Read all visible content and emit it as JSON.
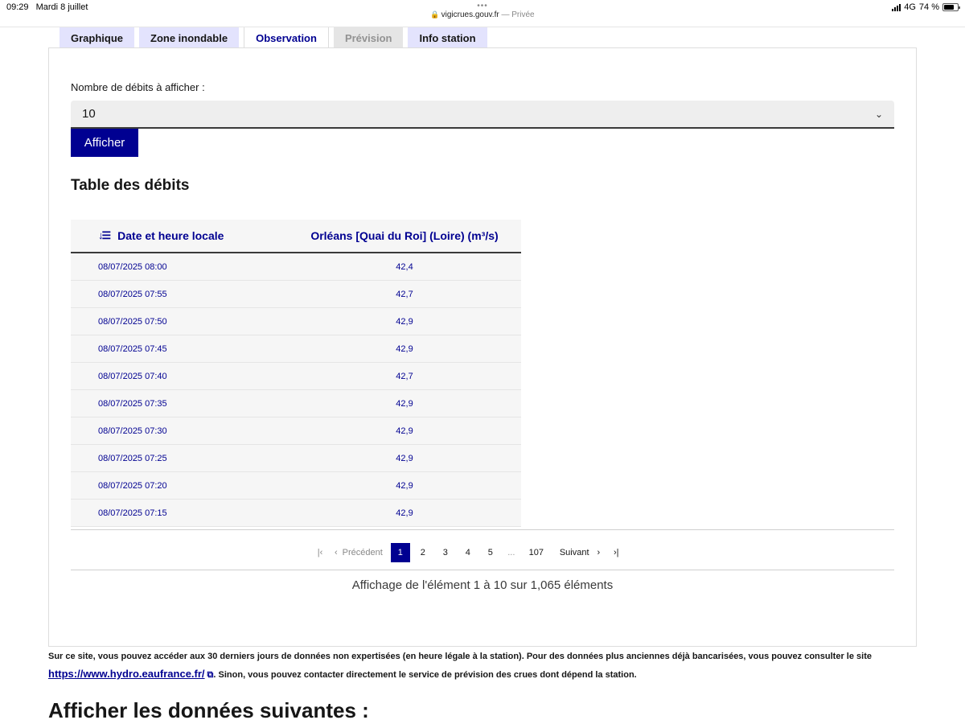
{
  "status_bar": {
    "time": "09:29",
    "date": "Mardi 8 juillet",
    "dots": "•••",
    "url": "vigicrues.gouv.fr",
    "privacy": "— Privée",
    "network": "4G",
    "battery": "74 %",
    "battery_level": 0.74
  },
  "tabs": [
    {
      "label": "Graphique",
      "state": "normal"
    },
    {
      "label": "Zone inondable",
      "state": "normal"
    },
    {
      "label": "Observation",
      "state": "active"
    },
    {
      "label": "Prévision",
      "state": "disabled"
    },
    {
      "label": "Info station",
      "state": "normal"
    }
  ],
  "form": {
    "label": "Nombre de débits à afficher :",
    "selected": "10",
    "button": "Afficher"
  },
  "table": {
    "title": "Table des débits",
    "headers": [
      "Date et heure locale",
      "Orléans [Quai du Roi] (Loire) (m³/s)"
    ],
    "rows": [
      [
        "08/07/2025 08:00",
        "42,4"
      ],
      [
        "08/07/2025 07:55",
        "42,7"
      ],
      [
        "08/07/2025 07:50",
        "42,9"
      ],
      [
        "08/07/2025 07:45",
        "42,9"
      ],
      [
        "08/07/2025 07:40",
        "42,7"
      ],
      [
        "08/07/2025 07:35",
        "42,9"
      ],
      [
        "08/07/2025 07:30",
        "42,9"
      ],
      [
        "08/07/2025 07:25",
        "42,9"
      ],
      [
        "08/07/2025 07:20",
        "42,9"
      ],
      [
        "08/07/2025 07:15",
        "42,9"
      ]
    ]
  },
  "pagination": {
    "previous": "Précédent",
    "pages": [
      "1",
      "2",
      "3",
      "4",
      "5"
    ],
    "ellipsis": "...",
    "last_page": "107",
    "next": "Suivant",
    "current": "1"
  },
  "summary": "Affichage de l'élément 1 à 10 sur 1,065 éléments",
  "info": {
    "text1": "Sur ce site, vous pouvez accéder aux 30 derniers jours de données non expertisées (en heure légale à la station). Pour des données plus anciennes déjà bancarisées, vous pouvez consulter le site ",
    "link": "https://www.hydro.eaufrance.fr/",
    "text2": ". Sinon, vous pouvez contacter directement le service de prévision des crues dont dépend la station."
  },
  "section_title": "Afficher les données suivantes :",
  "colors": {
    "primary": "#000091",
    "tab_bg": "#e3e3fd",
    "row_bg": "#f6f6f6"
  }
}
